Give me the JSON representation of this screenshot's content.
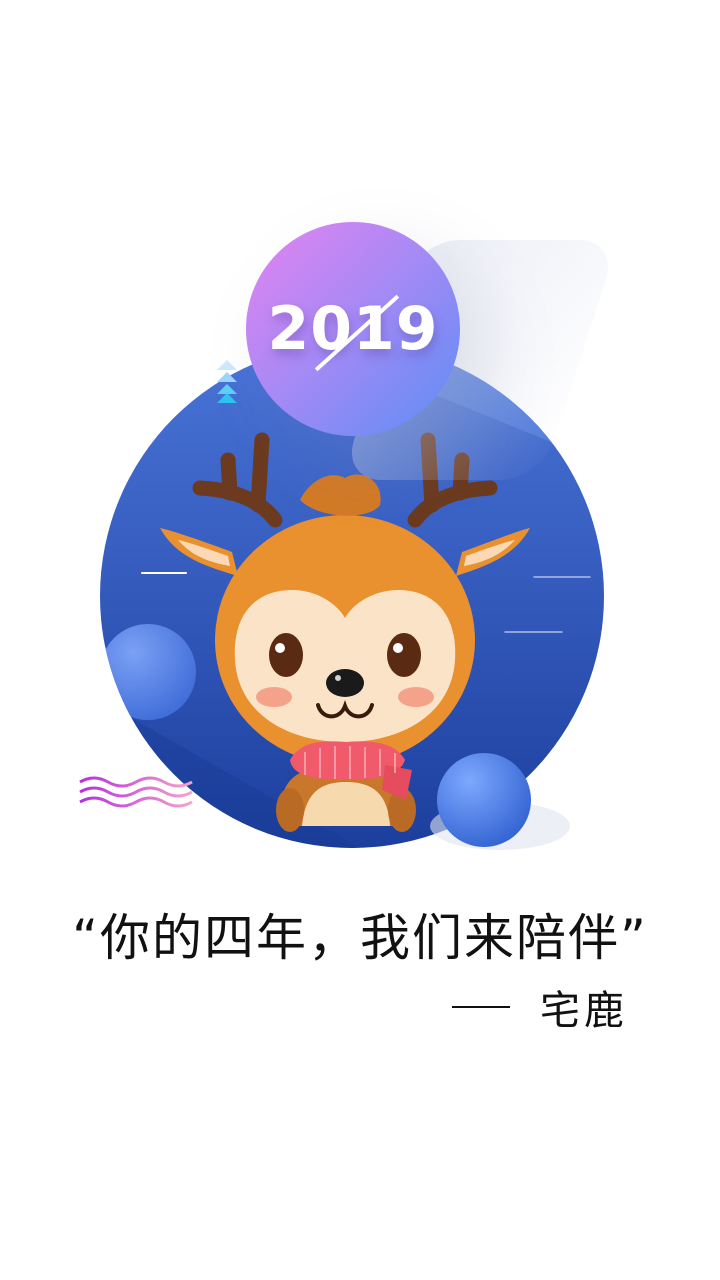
{
  "badge": {
    "year": "2019"
  },
  "quote": {
    "text": "“你的四年，我们来陪伴”"
  },
  "signature": {
    "name": "宅鹿"
  },
  "colors": {
    "big_circle_top": "#3f64c8",
    "big_circle_bottom": "#1f46a6",
    "badge_pink": "#e583f0",
    "badge_blue": "#5b8df5",
    "ball_blue": "#4f82e8",
    "deer_body": "#e9902f",
    "deer_face": "#fbe0c4",
    "antler": "#6b3a1f",
    "scarf": "#f05a6a"
  },
  "illustration": {
    "mascot": "deer-mascot",
    "decorations": [
      "triangle-stack-icon",
      "wave-lines-icon",
      "speed-lines"
    ]
  }
}
